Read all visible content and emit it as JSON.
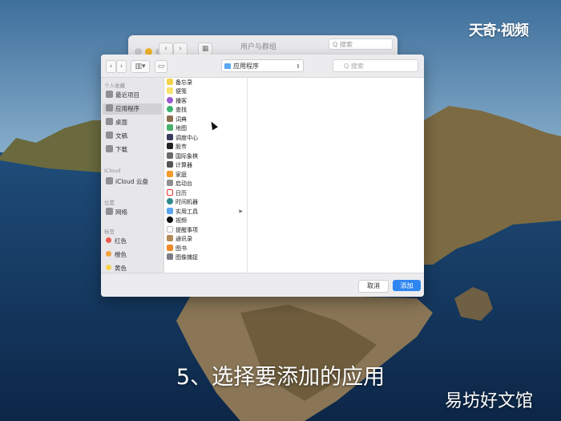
{
  "back_window": {
    "title": "用户与群组",
    "search_placeholder": "Q 搜索"
  },
  "toolbar": {
    "location": "应用程序",
    "search_placeholder": "Q 搜索"
  },
  "sidebar": {
    "favorites_header": "个人收藏",
    "favorites": [
      {
        "label": "最近项目",
        "icon": "clock-icon"
      },
      {
        "label": "应用程序",
        "icon": "apps-icon",
        "selected": true
      },
      {
        "label": "桌面",
        "icon": "desktop-icon"
      },
      {
        "label": "文稿",
        "icon": "document-icon"
      },
      {
        "label": "下载",
        "icon": "download-icon"
      }
    ],
    "icloud_header": "iCloud",
    "icloud": [
      {
        "label": "iCloud 云盘",
        "icon": "cloud-icon"
      }
    ],
    "locations_header": "位置",
    "locations": [
      {
        "label": "网络",
        "icon": "globe-icon"
      }
    ],
    "tags_header": "标签",
    "tags": [
      {
        "label": "红色",
        "color": "#f05a4f"
      },
      {
        "label": "橙色",
        "color": "#f4a33a"
      },
      {
        "label": "黄色",
        "color": "#f6d34a"
      }
    ]
  },
  "files": [
    {
      "name": "备忘录",
      "color": "#f3d34a"
    },
    {
      "name": "便笺",
      "color": "#f7e26b"
    },
    {
      "name": "播客",
      "color": "#9b59d0"
    },
    {
      "name": "查找",
      "color": "#3bb36b"
    },
    {
      "name": "词典",
      "color": "#8c6d4f"
    },
    {
      "name": "地图",
      "color": "#4caf6a"
    },
    {
      "name": "调度中心",
      "color": "#3a3a5e"
    },
    {
      "name": "股市",
      "color": "#222222"
    },
    {
      "name": "国际象棋",
      "color": "#6b6b6b"
    },
    {
      "name": "计算器",
      "color": "#555555"
    },
    {
      "name": "家庭",
      "color": "#f39a2b"
    },
    {
      "name": "启动台",
      "color": "#8e8e93"
    },
    {
      "name": "日历",
      "color": "#ffffff"
    },
    {
      "name": "时间机器",
      "color": "#2f8a8a"
    },
    {
      "name": "实用工具",
      "color": "#5aa6f0",
      "folder": true
    },
    {
      "name": "视频",
      "color": "#111111"
    },
    {
      "name": "提醒事项",
      "color": "#ffffff"
    },
    {
      "name": "通讯录",
      "color": "#b58a5a"
    },
    {
      "name": "图书",
      "color": "#f08a2b"
    },
    {
      "name": "图像捕捉",
      "color": "#7d7d85"
    }
  ],
  "buttons": {
    "cancel": "取消",
    "add": "添加"
  },
  "caption": "5、选择要添加的应用",
  "watermark_top": "天奇·视频",
  "watermark_bottom": "易坊好文馆"
}
